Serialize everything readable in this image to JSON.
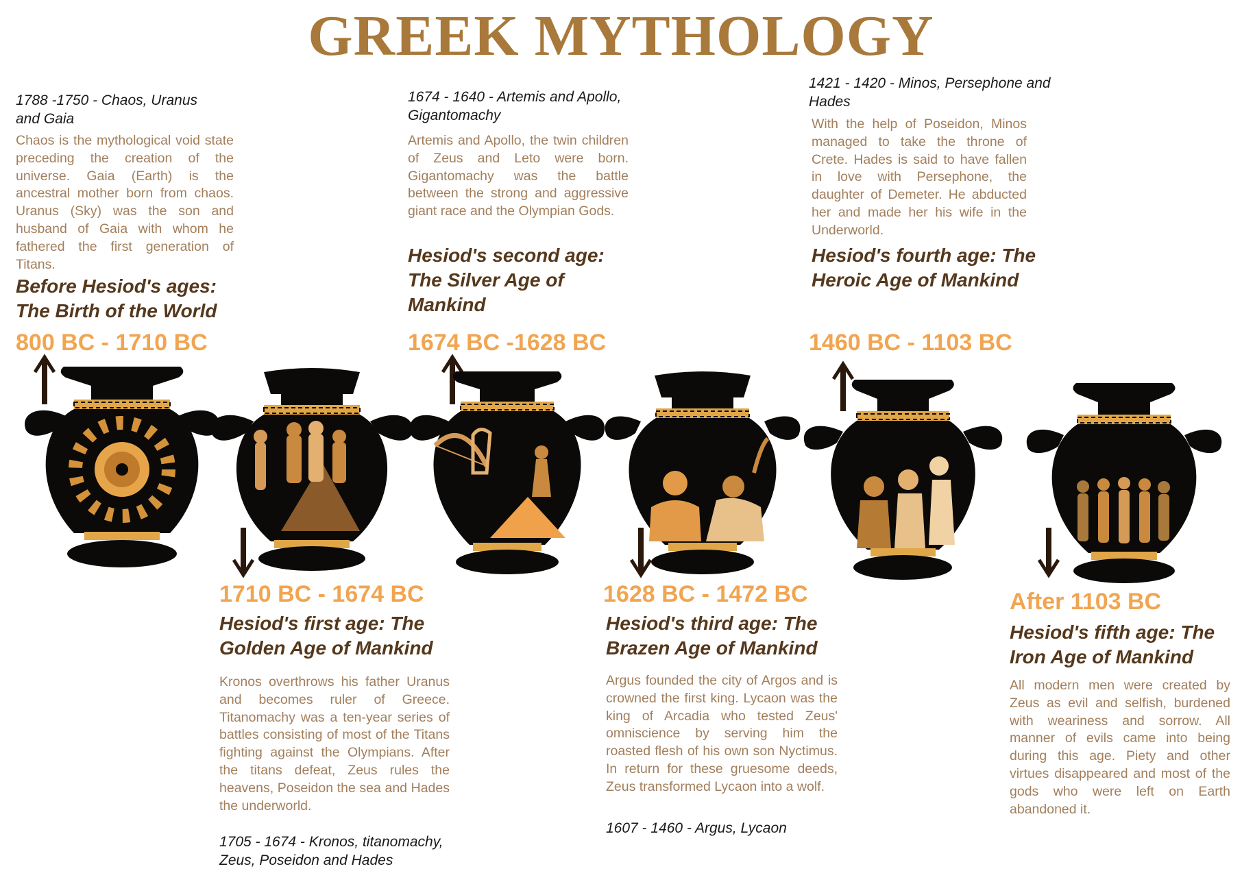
{
  "title": "GREEK MYTHOLOGY",
  "colors": {
    "title": "#a8793a",
    "date": "#f1a551",
    "age_heading": "#55381c",
    "description": "#a27f5c",
    "vase_body": "#0b0a08",
    "vase_ornament": "#e0a648"
  },
  "periods": [
    {
      "date": "800 BC - 1710 BC",
      "age": "Before Hesiod's ages: The Birth of the World",
      "events": "1788 -1750 - Chaos, Uranus and Gaia",
      "description": "Chaos is the mythological void state preceding the creation of the universe. Gaia (Earth) is the ancestral mother born from chaos. Uranus (Sky) was the son and husband of Gaia with whom he fathered the first generation of Titans.",
      "arrow": "up-arrow-icon",
      "vase_scene": "sun-face-icon"
    },
    {
      "date": "1710 BC - 1674 BC",
      "age": "Hesiod's first age: The Golden Age of Mankind",
      "events": "1705 - 1674 - Kronos, titanomachy, Zeus, Poseidon and Hades",
      "description": "Kronos overthrows his father Uranus and becomes ruler of Greece. Titanomachy was a ten-year series of battles consisting of most of the Titans fighting against the Olympians. After the titans defeat, Zeus rules the heavens, Poseidon the sea and Hades the underworld.",
      "arrow": "down-arrow-icon",
      "vase_scene": "titans-and-gods-scene"
    },
    {
      "date": "1674 BC -1628 BC",
      "age": "Hesiod's second age: The Silver Age of Mankind",
      "events": "1674 - 1640 -  Artemis and Apollo, Gigantomachy",
      "description": "Artemis and Apollo, the twin children of Zeus and Leto were born. Gigantomachy was the battle between the strong and aggressive giant race and the Olympian Gods.",
      "arrow": "up-arrow-icon",
      "vase_scene": "bow-and-lyre-scene"
    },
    {
      "date": "1628 BC - 1472 BC",
      "age": "Hesiod's third age: The Brazen Age of Mankind",
      "events": "1607 - 1460 - Argus, Lycaon",
      "description": "Argus founded the city of Argos and is crowned the first king. Lycaon was the king of Arcadia who tested Zeus' omniscience by serving him the roasted flesh of his own son Nyctimus. In return for these gruesome deeds, Zeus transformed Lycaon into a wolf.",
      "arrow": "down-arrow-icon",
      "vase_scene": "argus-and-wolf-scene"
    },
    {
      "date": "1460 BC - 1103 BC",
      "age": "Hesiod's fourth age: The Heroic Age of Mankind",
      "events": "1421 - 1420 - Minos, Persephone and Hades",
      "description": "With the help of Poseidon, Minos managed to take the throne of Crete. Hades is said to have fallen in love with Persephone, the daughter of Demeter. He abducted her and made her his wife in the Underworld.",
      "arrow": "up-arrow-icon",
      "vase_scene": "minos-hades-persephone-scene"
    },
    {
      "date": "After 1103 BC",
      "age": "Hesiod's fifth age: The Iron Age of Mankind",
      "description": "All modern men were created by Zeus as evil and selfish, burdened with weariness and sorrow. All manner of evils came into being during this age. Piety and other virtues disappeared and most of the gods who were left on Earth abandoned it.",
      "arrow": "down-arrow-icon",
      "vase_scene": "modern-men-scene"
    }
  ]
}
